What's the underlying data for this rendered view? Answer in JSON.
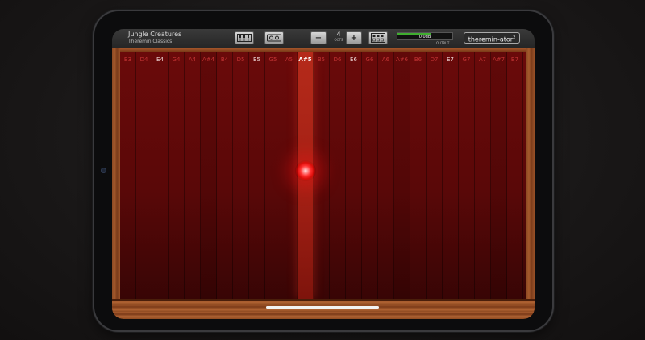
{
  "preset": {
    "name": "Jungle Creatures",
    "category": "Theremin Classics"
  },
  "toolbar": {
    "octave_value": "4",
    "octave_label": "OCTS",
    "minus_label": "−",
    "plus_label": "+",
    "output_value": "0.0dB",
    "output_label": "OUTPUT",
    "output_level": 0.6,
    "logo": "theremin-ator",
    "logo_sup": "2"
  },
  "keys": [
    {
      "label": "B3",
      "sharp": false
    },
    {
      "label": "D4",
      "sharp": false
    },
    {
      "label": "E4",
      "sharp": false
    },
    {
      "label": "G4",
      "sharp": false
    },
    {
      "label": "A4",
      "sharp": false
    },
    {
      "label": "A#4",
      "sharp": true
    },
    {
      "label": "B4",
      "sharp": false
    },
    {
      "label": "D5",
      "sharp": false
    },
    {
      "label": "E5",
      "sharp": false
    },
    {
      "label": "G5",
      "sharp": false
    },
    {
      "label": "A5",
      "sharp": false
    },
    {
      "label": "A#5",
      "sharp": true,
      "active": true
    },
    {
      "label": "B5",
      "sharp": false
    },
    {
      "label": "D6",
      "sharp": false
    },
    {
      "label": "E6",
      "sharp": false
    },
    {
      "label": "G6",
      "sharp": false
    },
    {
      "label": "A6",
      "sharp": false
    },
    {
      "label": "A#6",
      "sharp": true
    },
    {
      "label": "B6",
      "sharp": false
    },
    {
      "label": "D7",
      "sharp": false
    },
    {
      "label": "E7",
      "sharp": false
    },
    {
      "label": "G7",
      "sharp": false
    },
    {
      "label": "A7",
      "sharp": false
    },
    {
      "label": "A#7",
      "sharp": true
    },
    {
      "label": "B7",
      "sharp": false
    }
  ],
  "colors": {
    "field": "#6a0a0a",
    "active_key": "#b52a1a",
    "touch": "#ff3030",
    "wood": "#a65a2c"
  },
  "icons": {
    "keyboard": "keyboard-icon",
    "tape": "tape-icon",
    "scale": "scale-grid-icon"
  }
}
